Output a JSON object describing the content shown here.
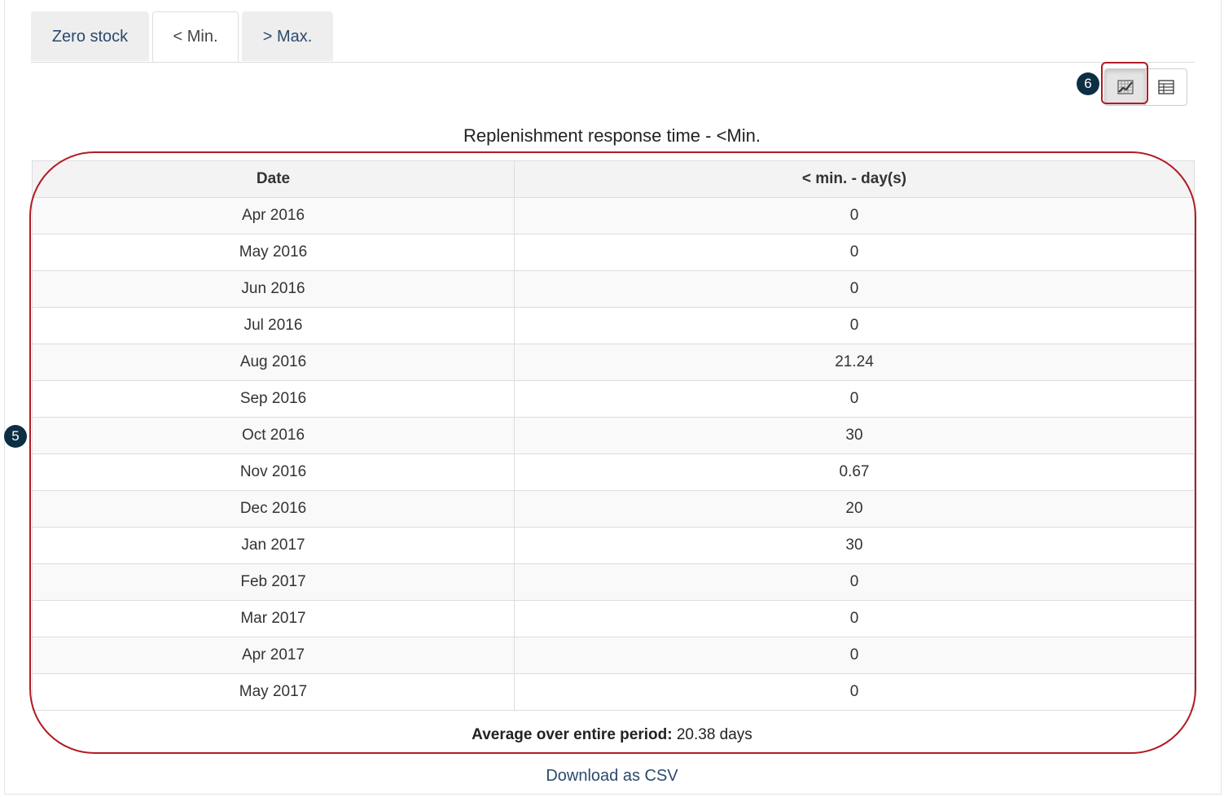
{
  "tabs": [
    {
      "label": "Zero stock",
      "active": false
    },
    {
      "label": "< Min.",
      "active": true
    },
    {
      "label": "> Max.",
      "active": false
    }
  ],
  "view_toggle": {
    "chart_icon": "chart-icon",
    "table_icon": "table-icon",
    "active": "chart"
  },
  "markers": {
    "table_callout": "5",
    "toggle_callout": "6"
  },
  "title": "Replenishment response time - <Min.",
  "table": {
    "headers": [
      "Date",
      "< min. - day(s)"
    ],
    "rows": [
      [
        "Apr 2016",
        "0"
      ],
      [
        "May 2016",
        "0"
      ],
      [
        "Jun 2016",
        "0"
      ],
      [
        "Jul 2016",
        "0"
      ],
      [
        "Aug 2016",
        "21.24"
      ],
      [
        "Sep 2016",
        "0"
      ],
      [
        "Oct 2016",
        "30"
      ],
      [
        "Nov 2016",
        "0.67"
      ],
      [
        "Dec 2016",
        "20"
      ],
      [
        "Jan 2017",
        "30"
      ],
      [
        "Feb 2017",
        "0"
      ],
      [
        "Mar 2017",
        "0"
      ],
      [
        "Apr 2017",
        "0"
      ],
      [
        "May 2017",
        "0"
      ]
    ]
  },
  "average": {
    "label": "Average over entire period:",
    "value": "20.38 days"
  },
  "download_link": "Download as CSV",
  "colors": {
    "highlight": "#b01c24",
    "marker": "#0d2f44",
    "link": "#2a4a6e"
  }
}
